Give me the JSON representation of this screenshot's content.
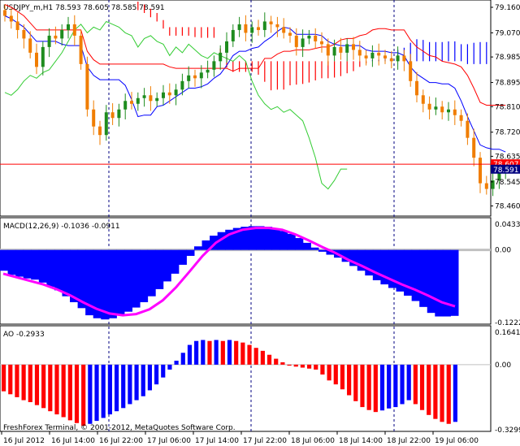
{
  "colors": {
    "background": "#ffffff",
    "bull_candle": "#1e8c1e",
    "bear_candle": "#f07d00",
    "tenkan": "#0000ff",
    "kijun": "#ff0000",
    "chikou": "#33cc33",
    "cloud_bull": "#0000ff",
    "cloud_bear": "#ff0000",
    "macd_hist": "#0000ff",
    "macd_signal": "#ff00ff",
    "ao_up": "#0000ff",
    "ao_down": "#ff0000",
    "price_line": "#ff0000",
    "price_box": "#ff0000",
    "price_box2": "#000080",
    "zero_line": "#c0c0c0",
    "grid": "#000080"
  },
  "chart_data": [
    {
      "type": "candlestick",
      "title": "USDJPY_m,H1  78.593 78.605 78.585 78.591",
      "price_axis": [
        "79.160",
        "79.070",
        "78.985",
        "78.895",
        "78.810",
        "78.720",
        "78.635",
        "78.545",
        "78.460"
      ],
      "ylim": [
        78.43,
        79.18
      ],
      "bid_label": "78.607",
      "last_label": "78.591",
      "indicators": [
        "Ichimoku tenkan",
        "Ichimoku kijun",
        "Ichimoku chikou",
        "Ichimoku cloud"
      ]
    },
    {
      "type": "bar",
      "title": "MACD(12,26,9) -0.1036 -0.0911",
      "axis_labels": [
        "0.0433",
        "0.00",
        "-0.1222"
      ],
      "ylim": [
        -0.1222,
        0.0433
      ],
      "histogram": [
        -0.035,
        -0.042,
        -0.045,
        -0.048,
        -0.05,
        -0.055,
        -0.062,
        -0.068,
        -0.078,
        -0.088,
        -0.098,
        -0.11,
        -0.115,
        -0.117,
        -0.115,
        -0.11,
        -0.104,
        -0.097,
        -0.088,
        -0.078,
        -0.066,
        -0.053,
        -0.04,
        -0.025,
        -0.01,
        0.006,
        0.016,
        0.024,
        0.03,
        0.034,
        0.037,
        0.039,
        0.04,
        0.04,
        0.039,
        0.036,
        0.032,
        0.027,
        0.02,
        0.012,
        0.004,
        -0.003,
        -0.008,
        -0.013,
        -0.02,
        -0.027,
        -0.035,
        -0.043,
        -0.051,
        -0.058,
        -0.064,
        -0.07,
        -0.077,
        -0.086,
        -0.096,
        -0.106,
        -0.112,
        -0.112,
        -0.111
      ],
      "signal": [
        -0.04,
        -0.046,
        -0.052,
        -0.058,
        -0.066,
        -0.076,
        -0.088,
        -0.099,
        -0.107,
        -0.11,
        -0.108,
        -0.1,
        -0.085,
        -0.063,
        -0.037,
        -0.01,
        0.012,
        0.026,
        0.034,
        0.037,
        0.037,
        0.034,
        0.026,
        0.016,
        0.005,
        -0.005,
        -0.017,
        -0.027,
        -0.038,
        -0.048,
        -0.058,
        -0.067,
        -0.077,
        -0.088,
        -0.095
      ],
      "last_value": -0.1036,
      "signal_value": -0.0911
    },
    {
      "type": "bar",
      "title": "AO -0.2933",
      "axis_labels": [
        "0.1641",
        "0.00",
        "-0.3299"
      ],
      "ylim": [
        -0.3299,
        0.1641
      ],
      "values": [
        -0.135,
        -0.15,
        -0.165,
        -0.18,
        -0.19,
        -0.205,
        -0.22,
        -0.236,
        -0.252,
        -0.266,
        -0.282,
        -0.296,
        -0.31,
        -0.3,
        -0.285,
        -0.27,
        -0.252,
        -0.236,
        -0.22,
        -0.2,
        -0.18,
        -0.16,
        -0.13,
        -0.1,
        -0.065,
        -0.025,
        0.02,
        0.06,
        0.1,
        0.12,
        0.125,
        0.12,
        0.125,
        0.12,
        0.125,
        0.12,
        0.112,
        0.1,
        0.085,
        0.07,
        0.05,
        0.03,
        0.012,
        -0.005,
        -0.01,
        -0.015,
        -0.02,
        -0.025,
        -0.05,
        -0.08,
        -0.1,
        -0.125,
        -0.155,
        -0.185,
        -0.215,
        -0.23,
        -0.24,
        -0.232,
        -0.222,
        -0.215,
        -0.2,
        -0.18,
        -0.2,
        -0.23,
        -0.255,
        -0.275,
        -0.29,
        -0.3,
        -0.29
      ],
      "last_value": -0.2933
    }
  ],
  "time_labels": [
    "16 Jul 2012",
    "16 Jul 14:00",
    "16 Jul 22:00",
    "17 Jul 06:00",
    "17 Jul 14:00",
    "17 Jul 22:00",
    "18 Jul 06:00",
    "18 Jul 14:00",
    "18 Jul 22:00",
    "19 Jul 06:00"
  ],
  "copyright": "FreshForex Terminal, © 2001-2012, MetaQuotes Software Corp."
}
